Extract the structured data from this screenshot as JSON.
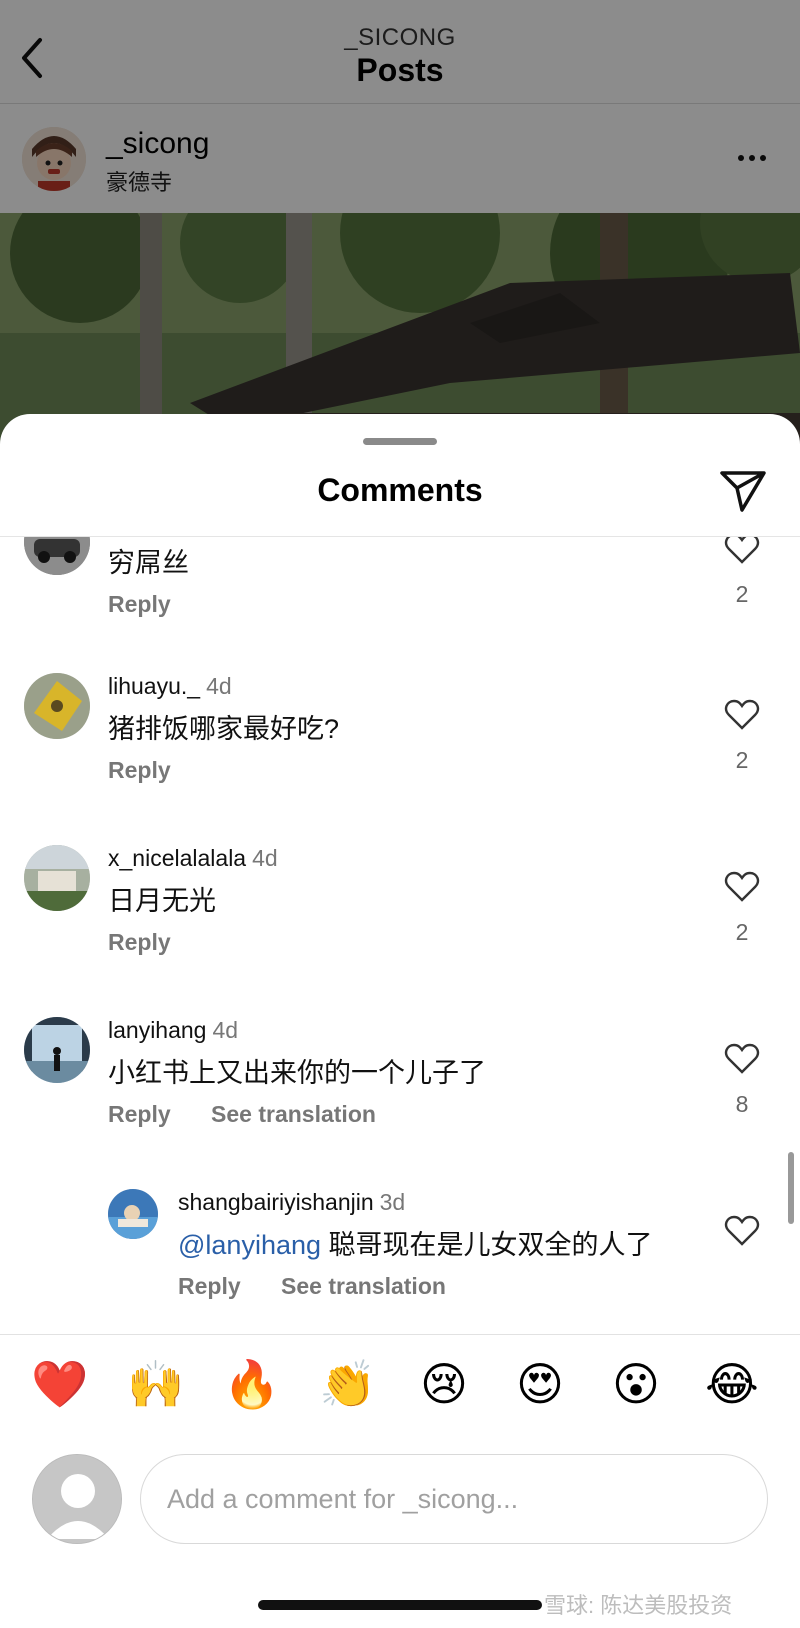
{
  "header": {
    "username": "_SICONG",
    "title": "Posts"
  },
  "post": {
    "username": "_sicong",
    "location": "豪德寺"
  },
  "sheet": {
    "title": "Comments"
  },
  "comments": [
    {
      "text": "穷屌丝",
      "reply_label": "Reply",
      "likes": "2"
    },
    {
      "user": "lihuayu._",
      "time": "4d",
      "text": "猪排饭哪家最好吃?",
      "reply_label": "Reply",
      "likes": "2"
    },
    {
      "user": "x_nicelalalala",
      "time": "4d",
      "text": "日月无光",
      "reply_label": "Reply",
      "likes": "2"
    },
    {
      "user": "lanyihang",
      "time": "4d",
      "text": "小红书上又出来你的一个儿子了",
      "reply_label": "Reply",
      "translate_label": "See translation",
      "likes": "8"
    },
    {
      "user": "shangbairiyishanjin",
      "time": "3d",
      "mention": "@lanyihang",
      "text": " 聪哥现在是儿女双全的人了",
      "reply_label": "Reply",
      "translate_label": "See translation"
    }
  ],
  "emoji_bar": [
    "❤️",
    "🙌",
    "🔥",
    "👏",
    "😢",
    "😍",
    "😮",
    "😂"
  ],
  "composer": {
    "placeholder": "Add a comment for _sicong..."
  },
  "watermark": "雪球: 陈达美股投资",
  "colors": {
    "mention": "#2a5fa8",
    "heart_emoji": "#e0242f"
  }
}
